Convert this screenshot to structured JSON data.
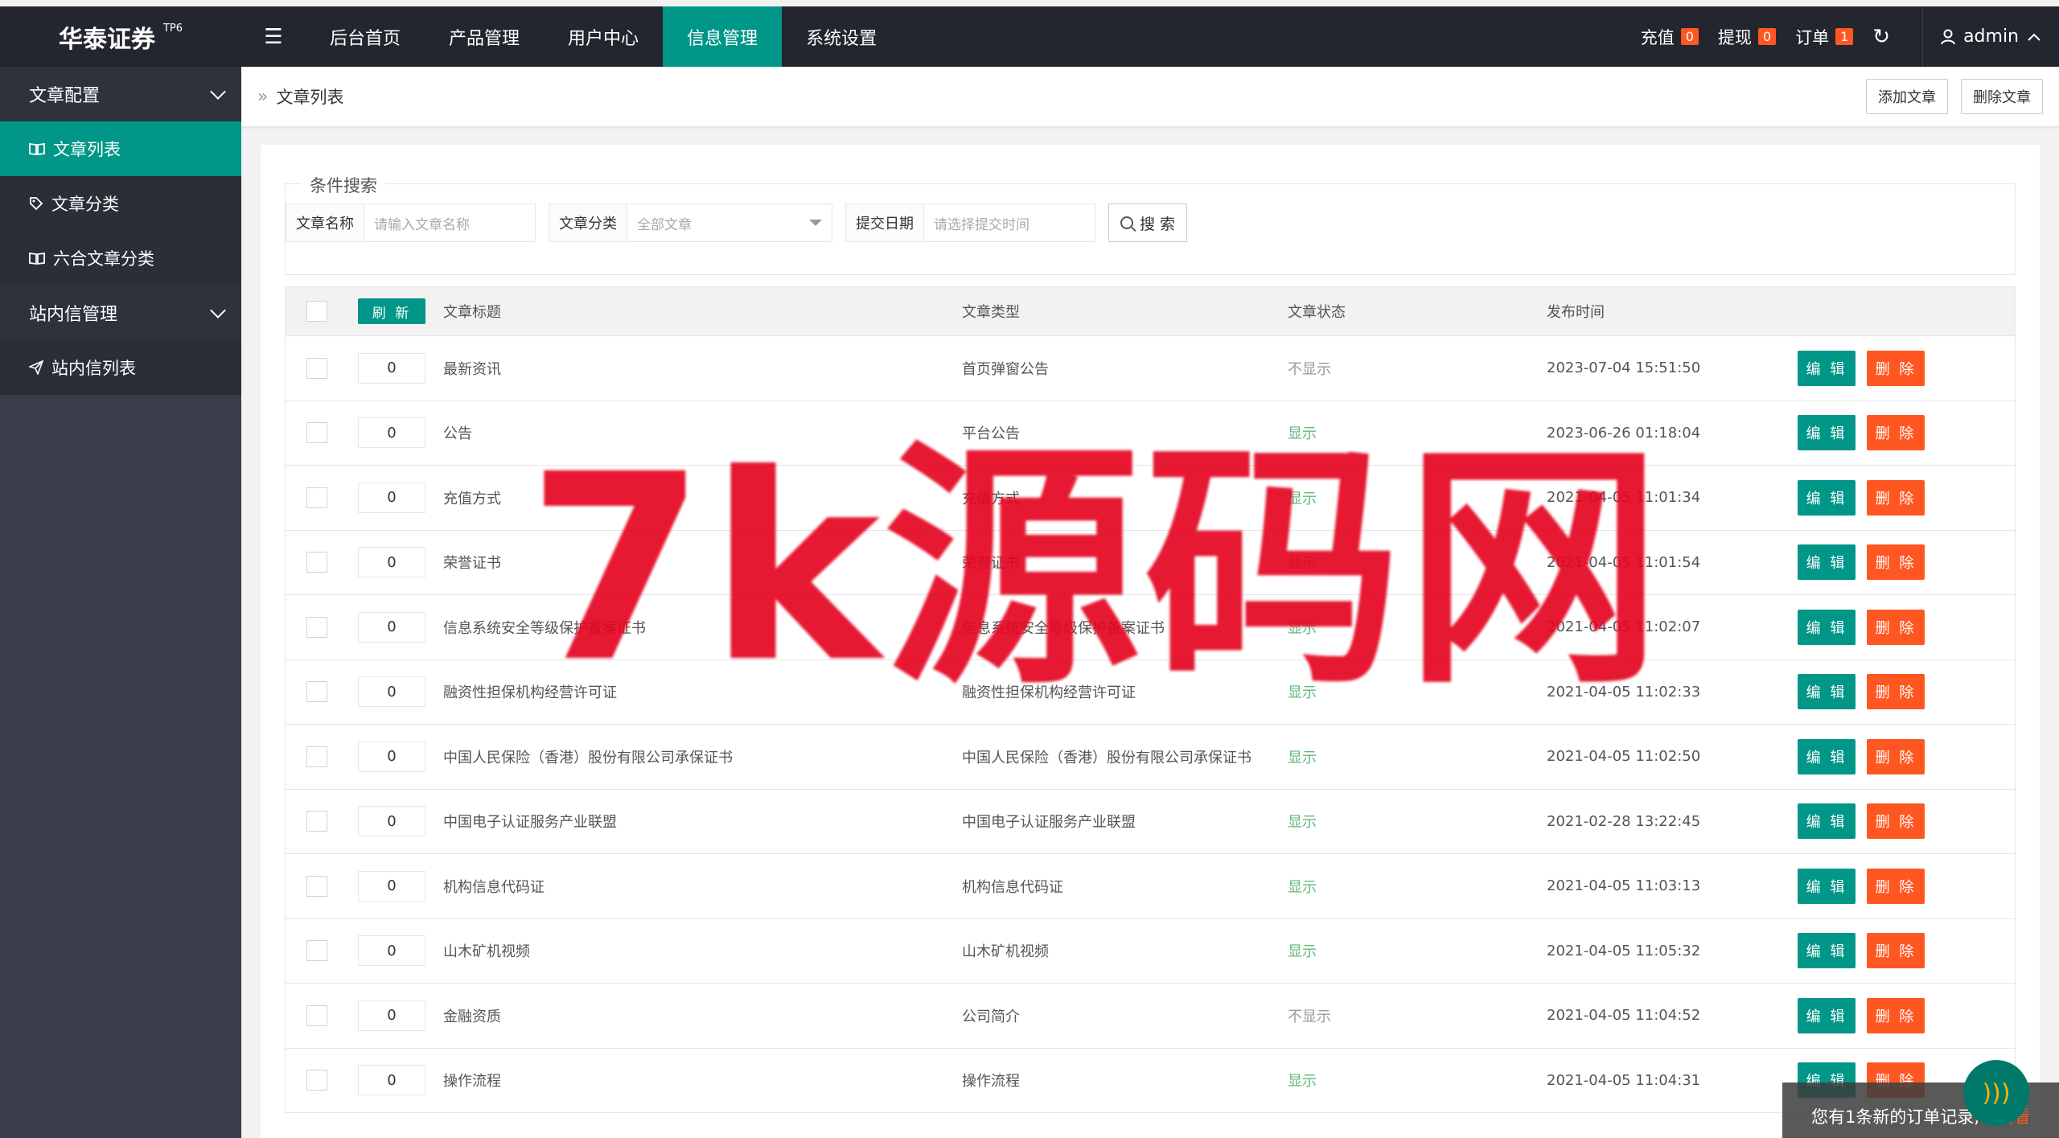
{
  "app": {
    "title": "华泰证券",
    "badge": "TP6"
  },
  "topnav": {
    "menu_icon": "hamburger-icon",
    "items": [
      {
        "label": "后台首页",
        "active": false
      },
      {
        "label": "产品管理",
        "active": false
      },
      {
        "label": "用户中心",
        "active": false
      },
      {
        "label": "信息管理",
        "active": true
      },
      {
        "label": "系统设置",
        "active": false
      }
    ],
    "right": {
      "recharge": {
        "label": "充值",
        "count": "0"
      },
      "withdraw": {
        "label": "提现",
        "count": "0"
      },
      "orders": {
        "label": "订单",
        "count": "1"
      },
      "user": "admin"
    }
  },
  "sidebar": {
    "groups": [
      {
        "label": "文章配置",
        "items": [
          {
            "label": "文章列表",
            "icon": "book-icon",
            "active": true
          },
          {
            "label": "文章分类",
            "icon": "tag-icon",
            "active": false
          },
          {
            "label": "六合文章分类",
            "icon": "book-icon",
            "active": false
          }
        ]
      },
      {
        "label": "站内信管理",
        "items": [
          {
            "label": "站内信列表",
            "icon": "send-icon",
            "active": false
          }
        ]
      }
    ]
  },
  "breadcrumb": {
    "current": "文章列表"
  },
  "actions": {
    "add": "添加文章",
    "delete": "删除文章"
  },
  "search": {
    "legend": "条件搜索",
    "name_label": "文章名称",
    "name_placeholder": "请输入文章名称",
    "category_label": "文章分类",
    "category_value": "全部文章",
    "date_label": "提交日期",
    "date_placeholder": "请选择提交时间",
    "button": "搜 索"
  },
  "table": {
    "refresh_button": "刷 新",
    "headers": {
      "title": "文章标题",
      "type": "文章类型",
      "status": "文章状态",
      "time": "发布时间"
    },
    "edit_label": "编 辑",
    "delete_label": "删 除",
    "rows": [
      {
        "sort": "0",
        "title": "最新资讯",
        "type": "首页弹窗公告",
        "status": "不显示",
        "time": "2023-07-04 15:51:50"
      },
      {
        "sort": "0",
        "title": "公告",
        "type": "平台公告",
        "status": "显示",
        "time": "2023-06-26 01:18:04"
      },
      {
        "sort": "0",
        "title": "充值方式",
        "type": "充值方式",
        "status": "显示",
        "time": "2021-04-05 11:01:34"
      },
      {
        "sort": "0",
        "title": "荣誉证书",
        "type": "荣誉证书",
        "status": "显示",
        "time": "2021-04-05 11:01:54"
      },
      {
        "sort": "0",
        "title": "信息系统安全等级保护备案证书",
        "type": "信息系统安全等级保护备案证书",
        "status": "显示",
        "time": "2021-04-05 11:02:07"
      },
      {
        "sort": "0",
        "title": "融资性担保机构经营许可证",
        "type": "融资性担保机构经营许可证",
        "status": "显示",
        "time": "2021-04-05 11:02:33"
      },
      {
        "sort": "0",
        "title": "中国人民保险（香港）股份有限公司承保证书",
        "type": "中国人民保险（香港）股份有限公司承保证书",
        "status": "显示",
        "time": "2021-04-05 11:02:50"
      },
      {
        "sort": "0",
        "title": "中国电子认证服务产业联盟",
        "type": "中国电子认证服务产业联盟",
        "status": "显示",
        "time": "2021-02-28 13:22:45"
      },
      {
        "sort": "0",
        "title": "机构信息代码证",
        "type": "机构信息代码证",
        "status": "显示",
        "time": "2021-04-05 11:03:13"
      },
      {
        "sort": "0",
        "title": "山木矿机视频",
        "type": "山木矿机视频",
        "status": "显示",
        "time": "2021-04-05 11:05:32"
      },
      {
        "sort": "0",
        "title": "金融资质",
        "type": "公司简介",
        "status": "不显示",
        "time": "2021-04-05 11:04:52"
      },
      {
        "sort": "0",
        "title": "操作流程",
        "type": "操作流程",
        "status": "显示",
        "time": "2021-04-05 11:04:31"
      }
    ]
  },
  "watermark": "7k源码网",
  "notification": {
    "text": "您有1条新的订单记录,",
    "link": "请查看"
  },
  "colors": {
    "primary": "#009688",
    "danger": "#ff5722",
    "header": "#23262e",
    "sidebar": "#393d49",
    "watermark": "#e40521"
  }
}
